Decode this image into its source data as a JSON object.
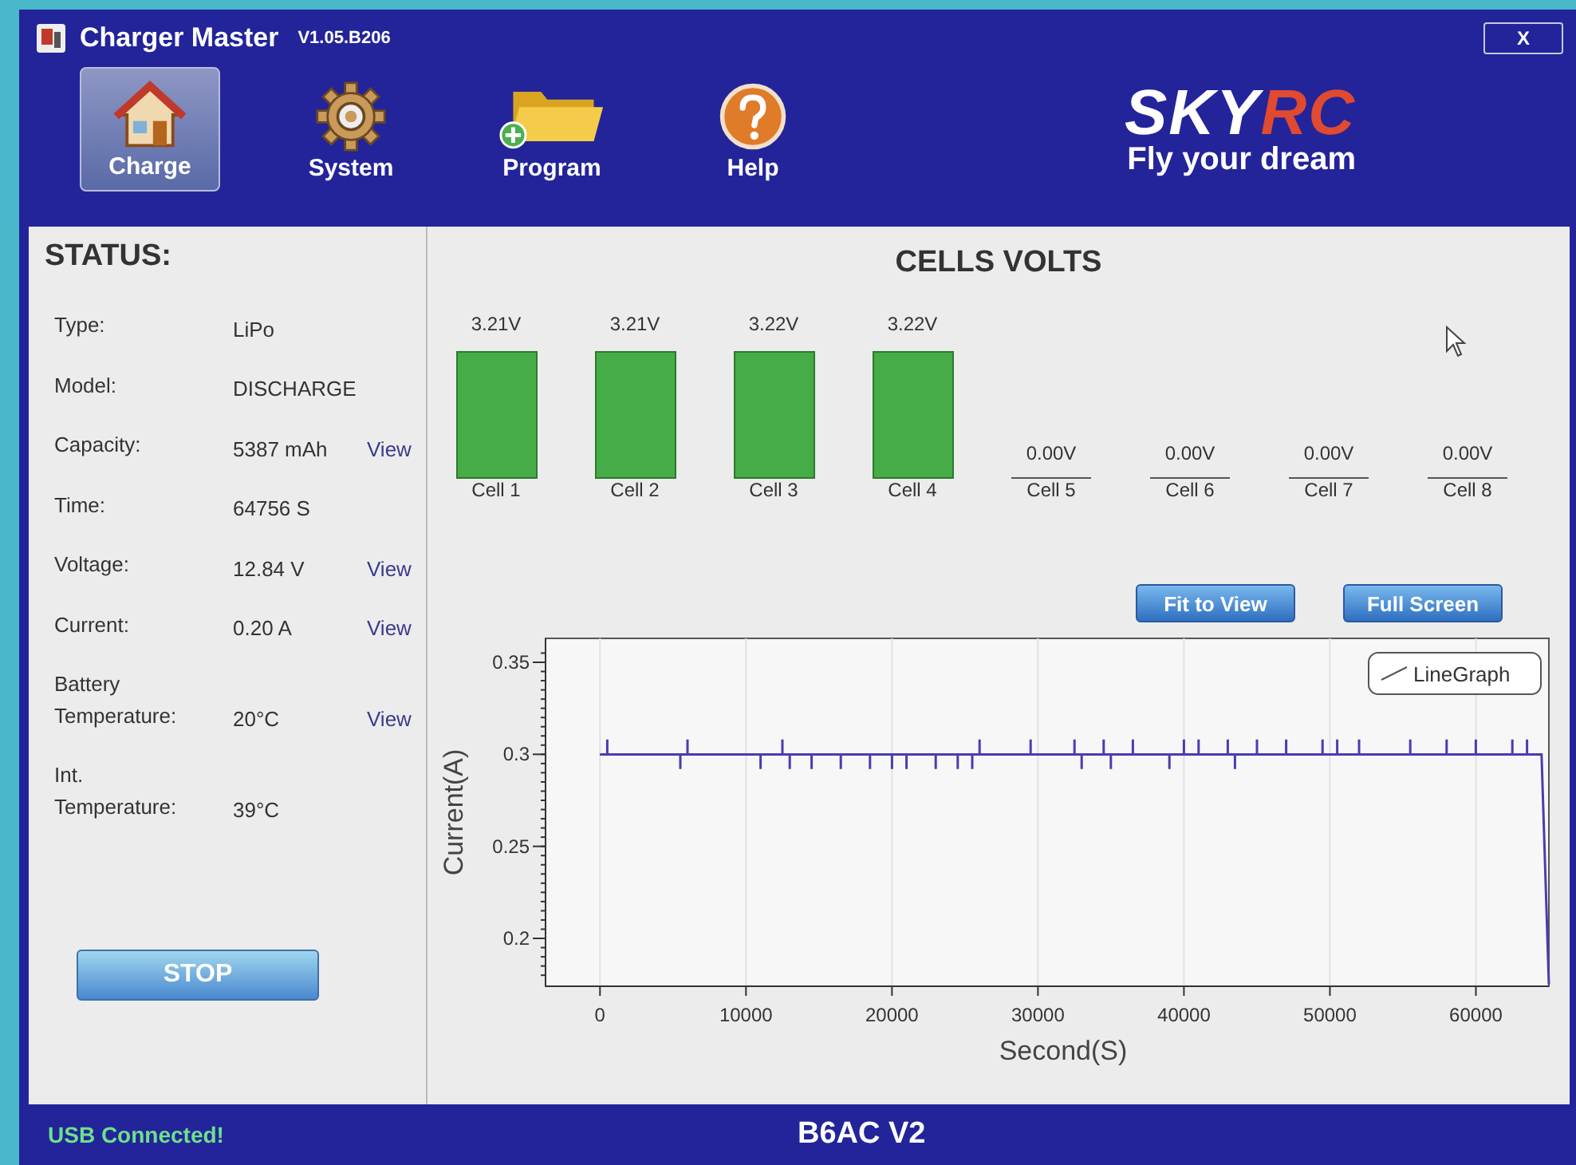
{
  "window": {
    "title": "Charger Master",
    "version": "V1.05.B206",
    "close": "X"
  },
  "nav": [
    {
      "label": "Charge",
      "kind": "house",
      "selected": true
    },
    {
      "label": "System",
      "kind": "gear",
      "selected": false
    },
    {
      "label": "Program",
      "kind": "folder",
      "selected": false
    },
    {
      "label": "Help",
      "kind": "help",
      "selected": false
    }
  ],
  "logo": {
    "part_1": "SKY",
    "part_2": "RC",
    "tagline": "Fly your dream"
  },
  "status": {
    "title": "STATUS:",
    "rows": [
      {
        "label": "Type:",
        "value": "LiPo"
      },
      {
        "label": "Model:",
        "value": "DISCHARGE"
      },
      {
        "label": "Capacity:",
        "value": "5387 mAh",
        "link": "View"
      },
      {
        "label": "Time:",
        "value": "64756 S"
      },
      {
        "label": "Voltage:",
        "value": "12.84 V",
        "link": "View"
      },
      {
        "label": "Current:",
        "value": "0.20 A",
        "link": "View"
      },
      {
        "label": "Battery Temperature:",
        "value": "20°C",
        "link": "View"
      },
      {
        "label": "Int. Temperature:",
        "value": "39°C"
      }
    ],
    "stop_button": "STOP"
  },
  "cells": {
    "title": "CELLS VOLTS",
    "items": [
      {
        "name": "Cell 1",
        "voltage": "3.21V",
        "active": true
      },
      {
        "name": "Cell 2",
        "voltage": "3.21V",
        "active": true
      },
      {
        "name": "Cell 3",
        "voltage": "3.22V",
        "active": true
      },
      {
        "name": "Cell 4",
        "voltage": "3.22V",
        "active": true
      },
      {
        "name": "Cell 5",
        "voltage": "0.00V",
        "active": false
      },
      {
        "name": "Cell 6",
        "voltage": "0.00V",
        "active": false
      },
      {
        "name": "Cell 7",
        "voltage": "0.00V",
        "active": false
      },
      {
        "name": "Cell 8",
        "voltage": "0.00V",
        "active": false
      }
    ]
  },
  "graph_buttons": [
    "Fit to View",
    "Full Screen"
  ],
  "graph": {
    "chart_data": {
      "type": "line",
      "grid": true,
      "xlabel": "Second(S)",
      "ylabel": "Current(A)",
      "xlim": [
        -3730,
        65000
      ],
      "ylim": [
        0.174,
        0.363
      ],
      "xticks": [
        0,
        10000,
        20000,
        30000,
        40000,
        50000,
        60000
      ],
      "yticks": [
        {
          "value": 0.2,
          "label": "0.2"
        },
        {
          "value": 0.25,
          "label": "0.25"
        },
        {
          "value": 0.3,
          "label": "0.3"
        },
        {
          "value": 0.35,
          "label": "0.35"
        }
      ],
      "x": [
        0,
        500,
        500,
        500,
        5500,
        5500,
        5500,
        6000,
        6000,
        6000,
        11000,
        11000,
        11000,
        12500,
        12500,
        12500,
        13000,
        13000,
        13000,
        14500,
        14500,
        14500,
        16500,
        16500,
        16500,
        18500,
        18500,
        18500,
        20000,
        20000,
        20000,
        21000,
        21000,
        21000,
        23000,
        23000,
        23000,
        24500,
        24500,
        24500,
        25500,
        25500,
        25500,
        26000,
        26000,
        26000,
        29500,
        29500,
        29500,
        32500,
        32500,
        32500,
        33000,
        33000,
        33000,
        34500,
        34500,
        34500,
        35000,
        35000,
        35000,
        36500,
        36500,
        36500,
        39000,
        39000,
        39000,
        40000,
        40000,
        40000,
        41000,
        41000,
        41000,
        43000,
        43000,
        43000,
        43500,
        43500,
        43500,
        45000,
        45000,
        45000,
        47000,
        47000,
        47000,
        49500,
        49500,
        49500,
        50500,
        50500,
        50500,
        52000,
        52000,
        52000,
        55500,
        55500,
        55500,
        58000,
        58000,
        58000,
        60000,
        60000,
        60000,
        62500,
        62500,
        62500,
        63500,
        63500,
        63500,
        64500,
        65000
      ],
      "series": [
        {
          "name": "LineGraph",
          "color": "#4a3cb0",
          "values": [
            0.3,
            0.3,
            0.308,
            0.3,
            0.3,
            0.292,
            0.3,
            0.3,
            0.308,
            0.3,
            0.3,
            0.292,
            0.3,
            0.3,
            0.308,
            0.3,
            0.3,
            0.292,
            0.3,
            0.3,
            0.292,
            0.3,
            0.3,
            0.292,
            0.3,
            0.3,
            0.292,
            0.3,
            0.3,
            0.292,
            0.3,
            0.3,
            0.292,
            0.3,
            0.3,
            0.292,
            0.3,
            0.3,
            0.292,
            0.3,
            0.3,
            0.292,
            0.3,
            0.3,
            0.308,
            0.3,
            0.3,
            0.308,
            0.3,
            0.3,
            0.308,
            0.3,
            0.3,
            0.292,
            0.3,
            0.3,
            0.308,
            0.3,
            0.3,
            0.292,
            0.3,
            0.3,
            0.308,
            0.3,
            0.3,
            0.292,
            0.3,
            0.3,
            0.308,
            0.3,
            0.3,
            0.308,
            0.3,
            0.3,
            0.308,
            0.3,
            0.3,
            0.292,
            0.3,
            0.3,
            0.308,
            0.3,
            0.3,
            0.308,
            0.3,
            0.3,
            0.308,
            0.3,
            0.3,
            0.308,
            0.3,
            0.3,
            0.308,
            0.3,
            0.3,
            0.308,
            0.3,
            0.3,
            0.308,
            0.3,
            0.3,
            0.308,
            0.3,
            0.3,
            0.308,
            0.3,
            0.3,
            0.308,
            0.3,
            0.3,
            0.175
          ]
        }
      ]
    }
  },
  "footer": {
    "connection": "USB Connected!",
    "device": "B6AC V2"
  }
}
